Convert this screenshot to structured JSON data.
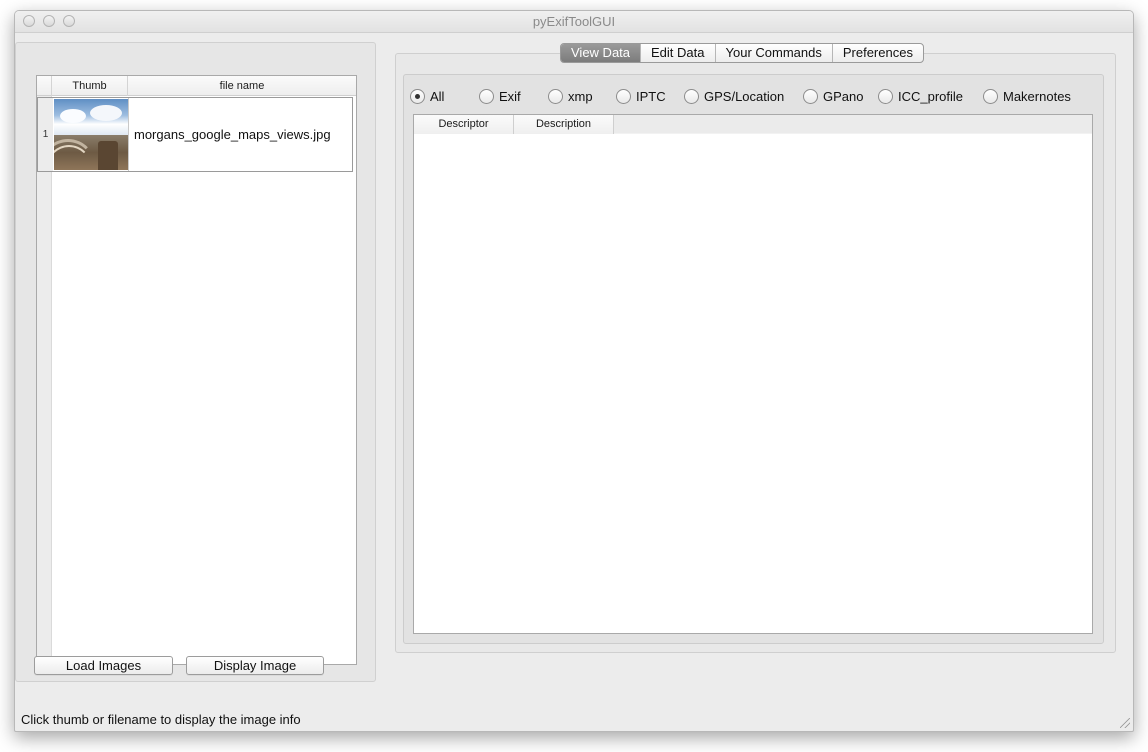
{
  "window": {
    "title": "pyExifToolGUI"
  },
  "file_table": {
    "headers": {
      "thumb": "Thumb",
      "file_name": "file name"
    },
    "rows": [
      {
        "index": "1",
        "file_name": "morgans_google_maps_views.jpg"
      }
    ]
  },
  "buttons": {
    "load_images": "Load Images",
    "display_image": "Display Image"
  },
  "tabs": [
    {
      "label": "View Data",
      "active": true
    },
    {
      "label": "Edit Data",
      "active": false
    },
    {
      "label": "Your Commands",
      "active": false
    },
    {
      "label": "Preferences",
      "active": false
    }
  ],
  "filters": [
    {
      "label": "All",
      "selected": true
    },
    {
      "label": "Exif",
      "selected": false
    },
    {
      "label": "xmp",
      "selected": false
    },
    {
      "label": "IPTC",
      "selected": false
    },
    {
      "label": "GPS/Location",
      "selected": false
    },
    {
      "label": "GPano",
      "selected": false
    },
    {
      "label": "ICC_profile",
      "selected": false
    },
    {
      "label": "Makernotes",
      "selected": false
    }
  ],
  "data_table": {
    "headers": {
      "descriptor": "Descriptor",
      "description": "Description"
    }
  },
  "status_bar": {
    "text": "Click thumb or filename to display the image info"
  }
}
